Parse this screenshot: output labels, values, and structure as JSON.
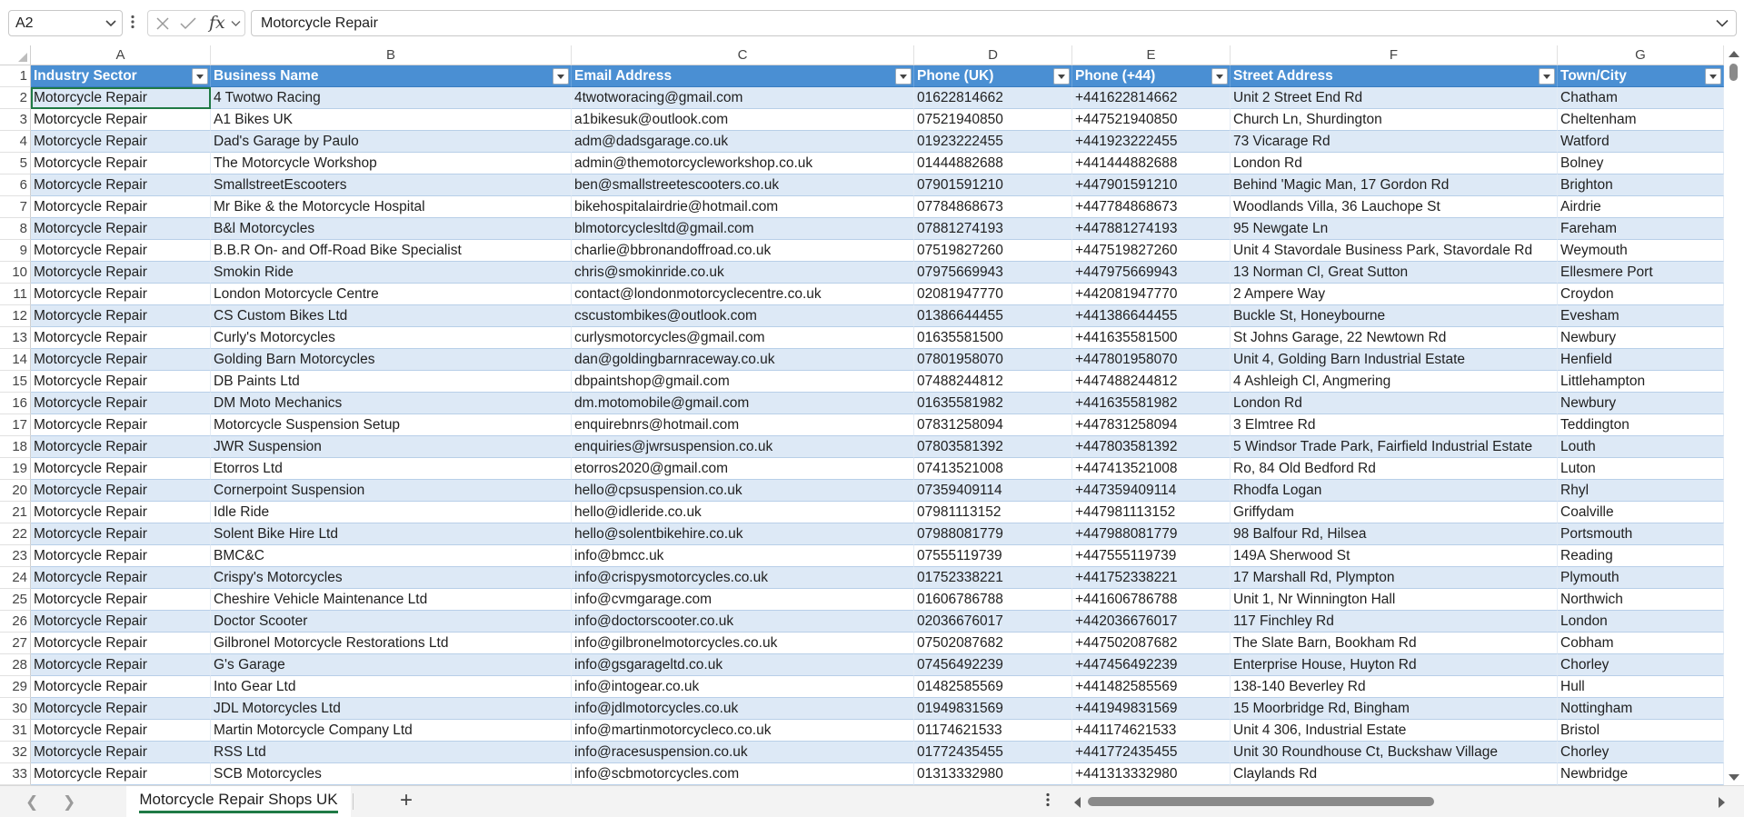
{
  "formula_bar": {
    "name_box": "A2",
    "fx_label": "fx",
    "formula_value": "Motorcycle Repair"
  },
  "columns": [
    "A",
    "B",
    "C",
    "D",
    "E",
    "F",
    "G"
  ],
  "table": {
    "headers": [
      "Industry Sector",
      "Business Name",
      "Email Address",
      "Phone (UK)",
      "Phone (+44)",
      "Street Address",
      "Town/City"
    ],
    "first_row_number": 2,
    "rows": [
      [
        "Motorcycle Repair",
        "4 Twotwo Racing",
        "4twotworacing@gmail.com",
        "01622814662",
        "+441622814662",
        "Unit 2 Street End Rd",
        "Chatham"
      ],
      [
        "Motorcycle Repair",
        "A1 Bikes UK",
        "a1bikesuk@outlook.com",
        "07521940850",
        "+447521940850",
        "Church Ln, Shurdington",
        "Cheltenham"
      ],
      [
        "Motorcycle Repair",
        "Dad's Garage by Paulo",
        "adm@dadsgarage.co.uk",
        "01923222455",
        "+441923222455",
        "73 Vicarage Rd",
        "Watford"
      ],
      [
        "Motorcycle Repair",
        "The Motorcycle Workshop",
        "admin@themotorcycleworkshop.co.uk",
        "01444882688",
        "+441444882688",
        "London Rd",
        "Bolney"
      ],
      [
        "Motorcycle Repair",
        "SmallstreetEscooters",
        "ben@smallstreetescooters.co.uk",
        "07901591210",
        "+447901591210",
        "Behind 'Magic Man, 17 Gordon Rd",
        "Brighton"
      ],
      [
        "Motorcycle Repair",
        "Mr Bike & the Motorcycle Hospital",
        "bikehospitalairdrie@hotmail.com",
        "07784868673",
        "+447784868673",
        "Woodlands Villa, 36 Lauchope St",
        "Airdrie"
      ],
      [
        "Motorcycle Repair",
        "B&l Motorcycles",
        "blmotorcyclesltd@gmail.com",
        "07881274193",
        "+447881274193",
        "95 Newgate Ln",
        "Fareham"
      ],
      [
        "Motorcycle Repair",
        "B.B.R On- and Off-Road Bike Specialist",
        "charlie@bbronandoffroad.co.uk",
        "07519827260",
        "+447519827260",
        "Unit 4 Stavordale Business Park, Stavordale Rd",
        "Weymouth"
      ],
      [
        "Motorcycle Repair",
        "Smokin Ride",
        "chris@smokinride.co.uk",
        "07975669943",
        "+447975669943",
        "13 Norman Cl, Great Sutton",
        "Ellesmere Port"
      ],
      [
        "Motorcycle Repair",
        "London Motorcycle Centre",
        "contact@londonmotorcyclecentre.co.uk",
        "02081947770",
        "+442081947770",
        "2 Ampere Way",
        "Croydon"
      ],
      [
        "Motorcycle Repair",
        "CS Custom Bikes Ltd",
        "cscustombikes@outlook.com",
        "01386644455",
        "+441386644455",
        "Buckle St, Honeybourne",
        "Evesham"
      ],
      [
        "Motorcycle Repair",
        "Curly's Motorcycles",
        "curlysmotorcycles@gmail.com",
        "01635581500",
        "+441635581500",
        "St Johns Garage, 22 Newtown Rd",
        "Newbury"
      ],
      [
        "Motorcycle Repair",
        "Golding Barn Motorcycles",
        "dan@goldingbarnraceway.co.uk",
        "07801958070",
        "+447801958070",
        "Unit 4, Golding Barn Industrial Estate",
        "Henfield"
      ],
      [
        "Motorcycle Repair",
        "DB Paints Ltd",
        "dbpaintshop@gmail.com",
        "07488244812",
        "+447488244812",
        "4 Ashleigh Cl, Angmering",
        "Littlehampton"
      ],
      [
        "Motorcycle Repair",
        "DM Moto Mechanics",
        "dm.motomobile@gmail.com",
        "01635581982",
        "+441635581982",
        "London Rd",
        "Newbury"
      ],
      [
        "Motorcycle Repair",
        "Motorcycle Suspension Setup",
        "enquirebnrs@hotmail.com",
        "07831258094",
        "+447831258094",
        "3 Elmtree Rd",
        "Teddington"
      ],
      [
        "Motorcycle Repair",
        "JWR Suspension",
        "enquiries@jwrsuspension.co.uk",
        "07803581392",
        "+447803581392",
        "5 Windsor Trade Park, Fairfield Industrial Estate",
        "Louth"
      ],
      [
        "Motorcycle Repair",
        "Etorros Ltd",
        "etorros2020@gmail.com",
        "07413521008",
        "+447413521008",
        "Ro, 84 Old Bedford Rd",
        "Luton"
      ],
      [
        "Motorcycle Repair",
        "Cornerpoint Suspension",
        "hello@cpsuspension.co.uk",
        "07359409114",
        "+447359409114",
        "Rhodfa Logan",
        "Rhyl"
      ],
      [
        "Motorcycle Repair",
        "Idle Ride",
        "hello@idleride.co.uk",
        "07981113152",
        "+447981113152",
        "Griffydam",
        "Coalville"
      ],
      [
        "Motorcycle Repair",
        "Solent Bike Hire Ltd",
        "hello@solentbikehire.co.uk",
        "07988081779",
        "+447988081779",
        "98 Balfour Rd, Hilsea",
        "Portsmouth"
      ],
      [
        "Motorcycle Repair",
        "BMC&C",
        "info@bmcc.uk",
        "07555119739",
        "+447555119739",
        "149A Sherwood St",
        "Reading"
      ],
      [
        "Motorcycle Repair",
        "Crispy's Motorcycles",
        "info@crispysmotorcycles.co.uk",
        "01752338221",
        "+441752338221",
        "17 Marshall Rd, Plympton",
        "Plymouth"
      ],
      [
        "Motorcycle Repair",
        "Cheshire Vehicle Maintenance Ltd",
        "info@cvmgarage.com",
        "01606786788",
        "+441606786788",
        "Unit 1, Nr Winnington Hall",
        "Northwich"
      ],
      [
        "Motorcycle Repair",
        "Doctor Scooter",
        "info@doctorscooter.co.uk",
        "02036676017",
        "+442036676017",
        "117 Finchley Rd",
        "London"
      ],
      [
        "Motorcycle Repair",
        "Gilbronel Motorcycle Restorations Ltd",
        "info@gilbronelmotorcycles.co.uk",
        "07502087682",
        "+447502087682",
        "The Slate Barn, Bookham Rd",
        "Cobham"
      ],
      [
        "Motorcycle Repair",
        "G's Garage",
        "info@gsgarageltd.co.uk",
        "07456492239",
        "+447456492239",
        "Enterprise House, Huyton Rd",
        "Chorley"
      ],
      [
        "Motorcycle Repair",
        "Into Gear Ltd",
        "info@intogear.co.uk",
        "01482585569",
        "+441482585569",
        "138-140 Beverley Rd",
        "Hull"
      ],
      [
        "Motorcycle Repair",
        "JDL Motorcycles Ltd",
        "info@jdlmotorcycles.co.uk",
        "01949831569",
        "+441949831569",
        "15 Moorbridge Rd, Bingham",
        "Nottingham"
      ],
      [
        "Motorcycle Repair",
        "Martin Motorcycle Company Ltd",
        "info@martinmotorcycleco.co.uk",
        "01174621533",
        "+441174621533",
        "Unit 4 306, Industrial Estate",
        "Bristol"
      ],
      [
        "Motorcycle Repair",
        "RSS Ltd",
        "info@racesuspension.co.uk",
        "01772435455",
        "+441772435455",
        "Unit 30 Roundhouse Ct, Buckshaw Village",
        "Chorley"
      ],
      [
        "Motorcycle Repair",
        "SCB Motorcycles",
        "info@scbmotorcycles.com",
        "01313332980",
        "+441313332980",
        "Claylands Rd",
        "Newbridge"
      ]
    ]
  },
  "sheet_tabs": {
    "active": "Motorcycle Repair Shops UK",
    "add_label": "+"
  },
  "colors": {
    "header_fill": "#4a8fd3",
    "band_fill": "#dde9f6",
    "active_accent": "#1f7a45"
  }
}
